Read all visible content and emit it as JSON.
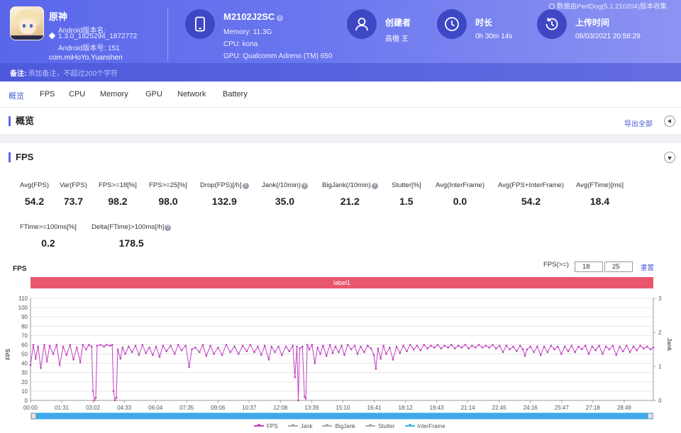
{
  "header": {
    "app": {
      "name": "原神",
      "version_label": "Android版本名:",
      "version": "1.3.0_1825294_1872772",
      "version_code": "Android版本号: 151",
      "package": "com.miHoYo.Yuanshen"
    },
    "device": {
      "model": "M2102J2SC",
      "memory": "Memory: 11.3G",
      "cpu": "CPU: kona",
      "gpu": "GPU: Qualcomm Adreno (TM) 650"
    },
    "creator": {
      "label": "创建者",
      "value": "高楷 王"
    },
    "duration": {
      "label": "时长",
      "value": "0h 30m 14s"
    },
    "upload": {
      "label": "上传时间",
      "value": "08/03/2021 20:58:29"
    },
    "perfdog_note": "数据由PerfDog(5.1.210204)版本收集",
    "remark": {
      "label": "备注:",
      "placeholder": "添加备注，不超过200个字符"
    }
  },
  "tabs": [
    "概览",
    "FPS",
    "CPU",
    "Memory",
    "GPU",
    "Network",
    "Battery"
  ],
  "overview": {
    "title": "概览",
    "export_label": "导出全部"
  },
  "fps_section": {
    "title": "FPS",
    "metrics": [
      {
        "label": "Avg(FPS)",
        "value": "54.2",
        "help": false
      },
      {
        "label": "Var(FPS)",
        "value": "73.7",
        "help": false
      },
      {
        "label": "FPS>=18[%]",
        "value": "98.2",
        "help": false
      },
      {
        "label": "FPS>=25[%]",
        "value": "98.0",
        "help": false
      },
      {
        "label": "Drop(FPS)[/h]",
        "value": "132.9",
        "help": true
      },
      {
        "label": "Jank(/10min)",
        "value": "35.0",
        "help": true
      },
      {
        "label": "BigJank(/10min)",
        "value": "21.2",
        "help": true
      },
      {
        "label": "Stutter[%]",
        "value": "1.5",
        "help": false
      },
      {
        "label": "Avg(InterFrame)",
        "value": "0.0",
        "help": false
      },
      {
        "label": "Avg(FPS+InterFrame)",
        "value": "54.2",
        "help": false
      },
      {
        "label": "Avg(FTime)[ms]",
        "value": "18.4",
        "help": false
      },
      {
        "label": "FTime>=100ms[%]",
        "value": "0.2",
        "help": false
      },
      {
        "label": "Delta(FTime)>100ms[/h]",
        "value": "178.5",
        "help": true
      }
    ],
    "chart_title": "FPS",
    "threshold_label": "FPS(>=)",
    "threshold_values": [
      "18",
      "25"
    ],
    "reset_label": "重置",
    "label_bar": "label1",
    "help_glyph": "?"
  },
  "chart_data": {
    "type": "line",
    "title": "FPS",
    "xlabel": "",
    "ylabel": "FPS",
    "y2label": "Jank",
    "ylim": [
      0,
      110
    ],
    "y2lim": [
      0,
      3
    ],
    "yticks": [
      "0",
      "10",
      "20",
      "30",
      "40",
      "50",
      "60",
      "70",
      "80",
      "90",
      "100",
      "110"
    ],
    "y2ticks": [
      "0",
      "1",
      "2",
      "3"
    ],
    "xticks": [
      "00:00",
      "01:31",
      "03:02",
      "04:33",
      "06:04",
      "07:35",
      "09:06",
      "10:37",
      "12:08",
      "13:39",
      "15:10",
      "16:41",
      "18:12",
      "19:43",
      "21:14",
      "22:45",
      "24:16",
      "25:47",
      "27:18",
      "28:49"
    ],
    "x_range_seconds": [
      0,
      1814
    ],
    "legend": [
      "FPS",
      "Jank",
      "BigJank",
      "Stutter",
      "InterFrame"
    ],
    "legend_position": "bottom",
    "series": [
      {
        "name": "FPS",
        "color": "#c13fc1",
        "points": [
          [
            0,
            38
          ],
          [
            8,
            60
          ],
          [
            15,
            45
          ],
          [
            22,
            58
          ],
          [
            30,
            35
          ],
          [
            40,
            60
          ],
          [
            48,
            42
          ],
          [
            56,
            59
          ],
          [
            66,
            50
          ],
          [
            76,
            60
          ],
          [
            85,
            38
          ],
          [
            95,
            58
          ],
          [
            105,
            49
          ],
          [
            115,
            60
          ],
          [
            125,
            44
          ],
          [
            135,
            57
          ],
          [
            145,
            41
          ],
          [
            152,
            60
          ],
          [
            162,
            55
          ],
          [
            170,
            60
          ],
          [
            178,
            58
          ],
          [
            182,
            10
          ],
          [
            186,
            0
          ],
          [
            190,
            3
          ],
          [
            194,
            59
          ],
          [
            204,
            60
          ],
          [
            214,
            58
          ],
          [
            222,
            60
          ],
          [
            232,
            59
          ],
          [
            238,
            60
          ],
          [
            242,
            10
          ],
          [
            246,
            0
          ],
          [
            250,
            3
          ],
          [
            254,
            55
          ],
          [
            262,
            45
          ],
          [
            268,
            57
          ],
          [
            276,
            50
          ],
          [
            286,
            58
          ],
          [
            296,
            52
          ],
          [
            306,
            59
          ],
          [
            316,
            49
          ],
          [
            326,
            60
          ],
          [
            336,
            51
          ],
          [
            346,
            57
          ],
          [
            356,
            49
          ],
          [
            366,
            58
          ],
          [
            376,
            47
          ],
          [
            386,
            59
          ],
          [
            396,
            53
          ],
          [
            408,
            59
          ],
          [
            420,
            50
          ],
          [
            430,
            60
          ],
          [
            440,
            54
          ],
          [
            452,
            59
          ],
          [
            462,
            36
          ],
          [
            470,
            55
          ],
          [
            480,
            57
          ],
          [
            492,
            52
          ],
          [
            502,
            60
          ],
          [
            512,
            48
          ],
          [
            524,
            59
          ],
          [
            534,
            50
          ],
          [
            546,
            57
          ],
          [
            558,
            49
          ],
          [
            570,
            60
          ],
          [
            582,
            52
          ],
          [
            594,
            58
          ],
          [
            606,
            50
          ],
          [
            618,
            59
          ],
          [
            630,
            53
          ],
          [
            640,
            60
          ],
          [
            652,
            52
          ],
          [
            662,
            58
          ],
          [
            672,
            49
          ],
          [
            682,
            59
          ],
          [
            694,
            44
          ],
          [
            702,
            58
          ],
          [
            712,
            52
          ],
          [
            722,
            58
          ],
          [
            732,
            49
          ],
          [
            744,
            58
          ],
          [
            754,
            53
          ],
          [
            764,
            59
          ],
          [
            770,
            25
          ],
          [
            776,
            58
          ],
          [
            780,
            0
          ],
          [
            784,
            56
          ],
          [
            792,
            58
          ],
          [
            798,
            4
          ],
          [
            802,
            2
          ],
          [
            806,
            60
          ],
          [
            812,
            55
          ],
          [
            820,
            60
          ],
          [
            828,
            40
          ],
          [
            836,
            57
          ],
          [
            844,
            50
          ],
          [
            852,
            59
          ],
          [
            862,
            48
          ],
          [
            872,
            60
          ],
          [
            880,
            51
          ],
          [
            888,
            58
          ],
          [
            898,
            52
          ],
          [
            906,
            59
          ],
          [
            914,
            49
          ],
          [
            924,
            60
          ],
          [
            934,
            55
          ],
          [
            944,
            59
          ],
          [
            952,
            50
          ],
          [
            962,
            58
          ],
          [
            972,
            52
          ],
          [
            982,
            59
          ],
          [
            992,
            56
          ],
          [
            1000,
            49
          ],
          [
            1006,
            34
          ],
          [
            1012,
            56
          ],
          [
            1020,
            45
          ],
          [
            1028,
            59
          ],
          [
            1036,
            50
          ],
          [
            1046,
            57
          ],
          [
            1056,
            44
          ],
          [
            1066,
            58
          ],
          [
            1076,
            51
          ],
          [
            1086,
            59
          ],
          [
            1096,
            53
          ],
          [
            1106,
            60
          ],
          [
            1116,
            55
          ],
          [
            1126,
            59
          ],
          [
            1136,
            54
          ],
          [
            1146,
            60
          ],
          [
            1156,
            56
          ],
          [
            1166,
            59
          ],
          [
            1176,
            57
          ],
          [
            1186,
            60
          ],
          [
            1196,
            56
          ],
          [
            1206,
            59
          ],
          [
            1216,
            57
          ],
          [
            1226,
            60
          ],
          [
            1236,
            56
          ],
          [
            1246,
            59
          ],
          [
            1256,
            57
          ],
          [
            1266,
            60
          ],
          [
            1276,
            56
          ],
          [
            1286,
            59
          ],
          [
            1296,
            57
          ],
          [
            1306,
            60
          ],
          [
            1316,
            57
          ],
          [
            1326,
            59
          ],
          [
            1336,
            57
          ],
          [
            1346,
            60
          ],
          [
            1356,
            56
          ],
          [
            1366,
            59
          ],
          [
            1376,
            52
          ],
          [
            1386,
            59
          ],
          [
            1396,
            55
          ],
          [
            1406,
            58
          ],
          [
            1416,
            53
          ],
          [
            1426,
            59
          ],
          [
            1434,
            55
          ],
          [
            1440,
            48
          ],
          [
            1446,
            55
          ],
          [
            1456,
            58
          ],
          [
            1466,
            52
          ],
          [
            1476,
            58
          ],
          [
            1486,
            49
          ],
          [
            1496,
            58
          ],
          [
            1506,
            52
          ],
          [
            1516,
            59
          ],
          [
            1526,
            55
          ],
          [
            1536,
            58
          ],
          [
            1546,
            50
          ],
          [
            1556,
            58
          ],
          [
            1566,
            53
          ],
          [
            1576,
            59
          ],
          [
            1586,
            52
          ],
          [
            1596,
            58
          ],
          [
            1606,
            55
          ],
          [
            1616,
            59
          ],
          [
            1626,
            50
          ],
          [
            1636,
            58
          ],
          [
            1646,
            54
          ],
          [
            1656,
            59
          ],
          [
            1666,
            50
          ],
          [
            1676,
            58
          ],
          [
            1686,
            55
          ],
          [
            1696,
            59
          ],
          [
            1706,
            49
          ],
          [
            1716,
            58
          ],
          [
            1726,
            53
          ],
          [
            1736,
            59
          ],
          [
            1746,
            52
          ],
          [
            1756,
            58
          ],
          [
            1766,
            54
          ],
          [
            1776,
            59
          ],
          [
            1786,
            56
          ],
          [
            1796,
            58
          ],
          [
            1806,
            55
          ],
          [
            1814,
            57
          ]
        ]
      },
      {
        "name": "Jank",
        "color": "#a9a9a9",
        "points": []
      },
      {
        "name": "BigJank",
        "color": "#a9a9a9",
        "points": []
      },
      {
        "name": "Stutter",
        "color": "#a9a9a9",
        "points": []
      },
      {
        "name": "InterFrame",
        "color": "#40b4e8",
        "points": []
      }
    ]
  }
}
